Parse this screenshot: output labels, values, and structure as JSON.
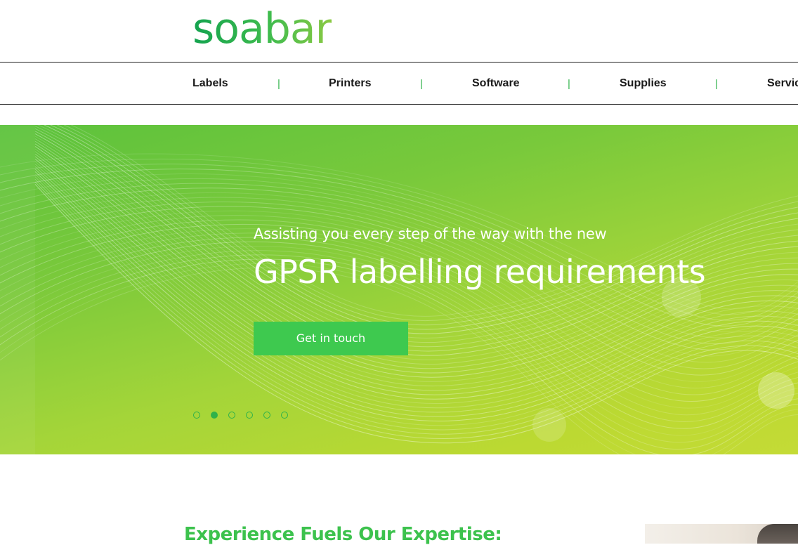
{
  "brand": {
    "logo_text": "soabar"
  },
  "nav": {
    "items": [
      "Labels",
      "Printers",
      "Software",
      "Supplies",
      "Servic"
    ],
    "separator": "|"
  },
  "hero": {
    "subtitle": "Assisting you every step of the way with the new",
    "title": "GPSR labelling requirements",
    "cta_label": "Get in touch",
    "slide_count": 6,
    "active_slide": 2
  },
  "section": {
    "heading": "Experience Fuels Our Expertise:"
  },
  "colors": {
    "brand_green": "#2fb24a",
    "cta_green": "#3ec94f",
    "heading_green": "#3cc24d",
    "hero_start": "#5cc23d",
    "hero_end": "#c4db36"
  }
}
